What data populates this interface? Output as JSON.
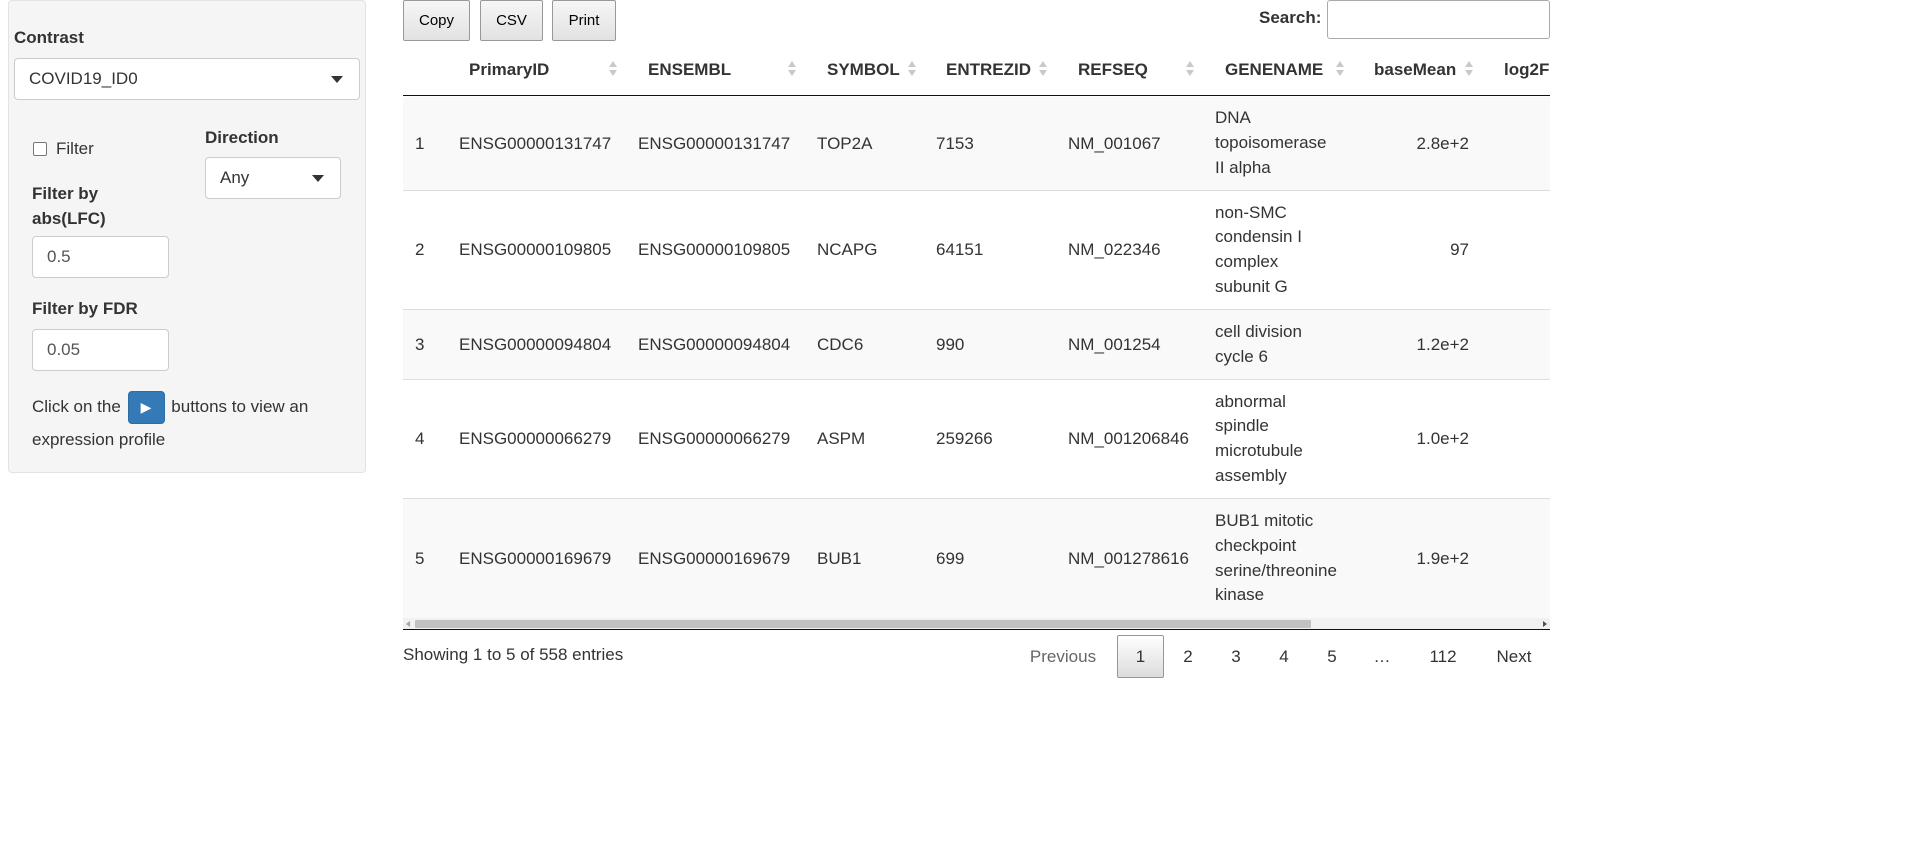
{
  "sidebar": {
    "contrast_label": "Contrast",
    "contrast_value": "COVID19_ID0",
    "filter_label": "Filter",
    "filter_checked": false,
    "direction_label": "Direction",
    "direction_value": "Any",
    "lfc_label": "Filter by abs(LFC)",
    "lfc_value": "0.5",
    "fdr_label": "Filter by FDR",
    "fdr_value": "0.05",
    "hint_before": "Click on the",
    "hint_button": "▶",
    "hint_after": "buttons to view an expression profile"
  },
  "toolbar": {
    "copy_label": "Copy",
    "csv_label": "CSV",
    "print_label": "Print",
    "search_label": "Search:",
    "search_value": ""
  },
  "table": {
    "columns": [
      "",
      "PrimaryID",
      "ENSEMBL",
      "SYMBOL",
      "ENTREZID",
      "REFSEQ",
      "GENENAME",
      "baseMean",
      "log2F"
    ],
    "rows": [
      {
        "idx": "1",
        "primary": "ENSG00000131747",
        "ensembl": "ENSG00000131747",
        "symbol": "TOP2A",
        "entrez": "7153",
        "refseq": "NM_001067",
        "genename": "DNA topoisomerase II alpha",
        "basemean": "2.8e+2"
      },
      {
        "idx": "2",
        "primary": "ENSG00000109805",
        "ensembl": "ENSG00000109805",
        "symbol": "NCAPG",
        "entrez": "64151",
        "refseq": "NM_022346",
        "genename": "non-SMC condensin I complex subunit G",
        "basemean": "97"
      },
      {
        "idx": "3",
        "primary": "ENSG00000094804",
        "ensembl": "ENSG00000094804",
        "symbol": "CDC6",
        "entrez": "990",
        "refseq": "NM_001254",
        "genename": "cell division cycle 6",
        "basemean": "1.2e+2"
      },
      {
        "idx": "4",
        "primary": "ENSG00000066279",
        "ensembl": "ENSG00000066279",
        "symbol": "ASPM",
        "entrez": "259266",
        "refseq": "NM_001206846",
        "genename": "abnormal spindle microtubule assembly",
        "basemean": "1.0e+2"
      },
      {
        "idx": "5",
        "primary": "ENSG00000169679",
        "ensembl": "ENSG00000169679",
        "symbol": "BUB1",
        "entrez": "699",
        "refseq": "NM_001278616",
        "genename": "BUB1 mitotic checkpoint serine/threonine kinase",
        "basemean": "1.9e+2"
      }
    ]
  },
  "footer": {
    "info": "Showing 1 to 5 of 558 entries",
    "previous": "Previous",
    "pages": [
      "1",
      "2",
      "3",
      "4",
      "5",
      "…",
      "112"
    ],
    "current_page": "1",
    "next": "Next"
  }
}
